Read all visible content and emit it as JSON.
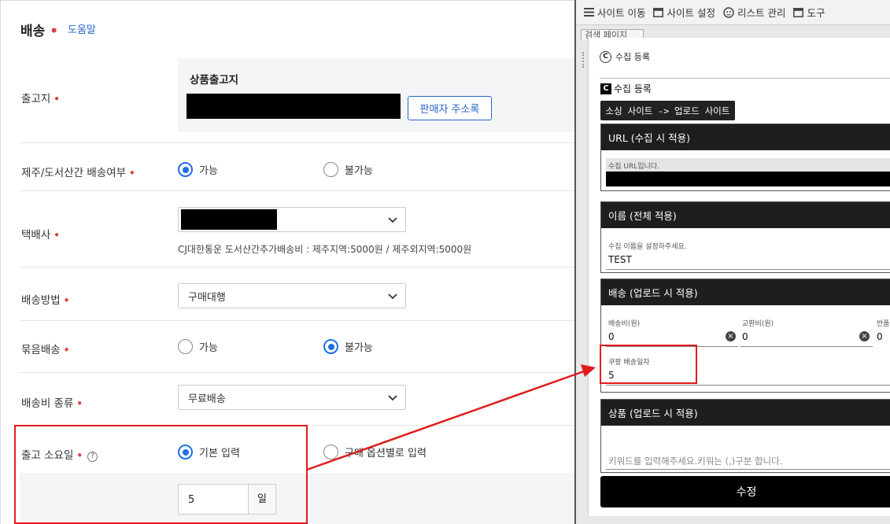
{
  "form": {
    "title": "배송",
    "help": "도움말",
    "required_mark": "•",
    "warehouse": {
      "label": "출고지",
      "inner_title": "상품출고지",
      "address_book_button": "판매자 주소록"
    },
    "jeju": {
      "label": "제주/도서산간 배송여부",
      "options": [
        "가능",
        "불가능"
      ],
      "selected": "가능"
    },
    "courier": {
      "label": "택배사",
      "note": "CJ대한통운 도서산간추가배송비 : 제주지역:5000원 / 제주외지역:5000원"
    },
    "method": {
      "label": "배송방법",
      "value": "구매대행"
    },
    "bundle": {
      "label": "묶음배송",
      "options": [
        "가능",
        "불가능"
      ],
      "selected": "불가능"
    },
    "fee_type": {
      "label": "배송비 종류",
      "value": "무료배송"
    },
    "lead_time": {
      "label": "출고 소요일",
      "options": [
        "기본 입력",
        "구매 옵션별로 입력"
      ],
      "selected": "기본 입력",
      "value": "5",
      "unit": "일",
      "help_icon": "?"
    }
  },
  "toolbar": {
    "items": [
      {
        "icon": "menu-icon",
        "label": "사이트 이동"
      },
      {
        "icon": "window-icon",
        "label": "사이트 설정"
      },
      {
        "icon": "person-icon",
        "label": "리스트 관리"
      },
      {
        "icon": "window-icon",
        "label": "도구"
      }
    ],
    "page_tab": "검색 페이지"
  },
  "panel": {
    "collect_header": "수집 등록",
    "collect_sub": "수집 등록",
    "tooltip": "소싱 사이트 -> 업로드 사이트",
    "url_section": {
      "title": "URL (수집 시 적용)",
      "field_label": "수집 URL입니다."
    },
    "name_section": {
      "title": "이름 (전체 적용)",
      "field_label": "수집 이름을 설정하주세요.",
      "value": "TEST"
    },
    "ship_section": {
      "title": "배송 (업로드 시 적용)",
      "fee_label": "배송비(원)",
      "fee_value": "0",
      "exchange_label": "교환비(원)",
      "exchange_value": "0",
      "return_label": "반품",
      "return_value": "0",
      "coupang_label": "쿠팡 배송일자",
      "coupang_value": "5"
    },
    "product_section": {
      "title": "상품 (업로드 시 적용)",
      "placeholder": "키워드를 입력해주세요.키워는 (,)구분 합니다."
    },
    "submit": "수정"
  },
  "colors": {
    "accent": "#1f6fe5",
    "highlight": "#e01b1b",
    "dark": "#1e1e1e"
  }
}
